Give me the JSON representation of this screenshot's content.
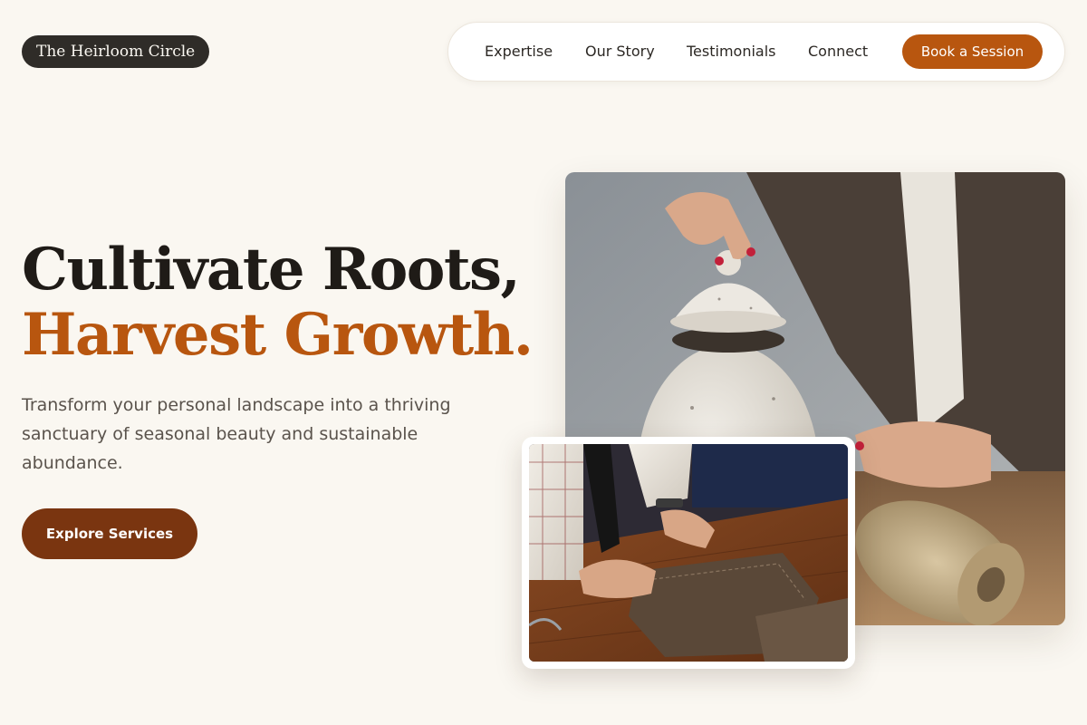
{
  "brand": {
    "name": "The Heirloom Circle"
  },
  "nav": {
    "links": [
      "Expertise",
      "Our Story",
      "Testimonials",
      "Connect"
    ],
    "cta_label": "Book a Session"
  },
  "hero": {
    "headline_line1": "Cultivate Roots,",
    "headline_line2": "Harvest Growth.",
    "description": "Transform your personal landscape into a thriving sanctuary of seasonal beauty and sustainable abundance.",
    "cta_label": "Explore Services"
  },
  "colors": {
    "background": "#faf7f1",
    "accent": "#b8560f",
    "accent_dark": "#7a3510",
    "logo_bg": "#2f2c28"
  }
}
